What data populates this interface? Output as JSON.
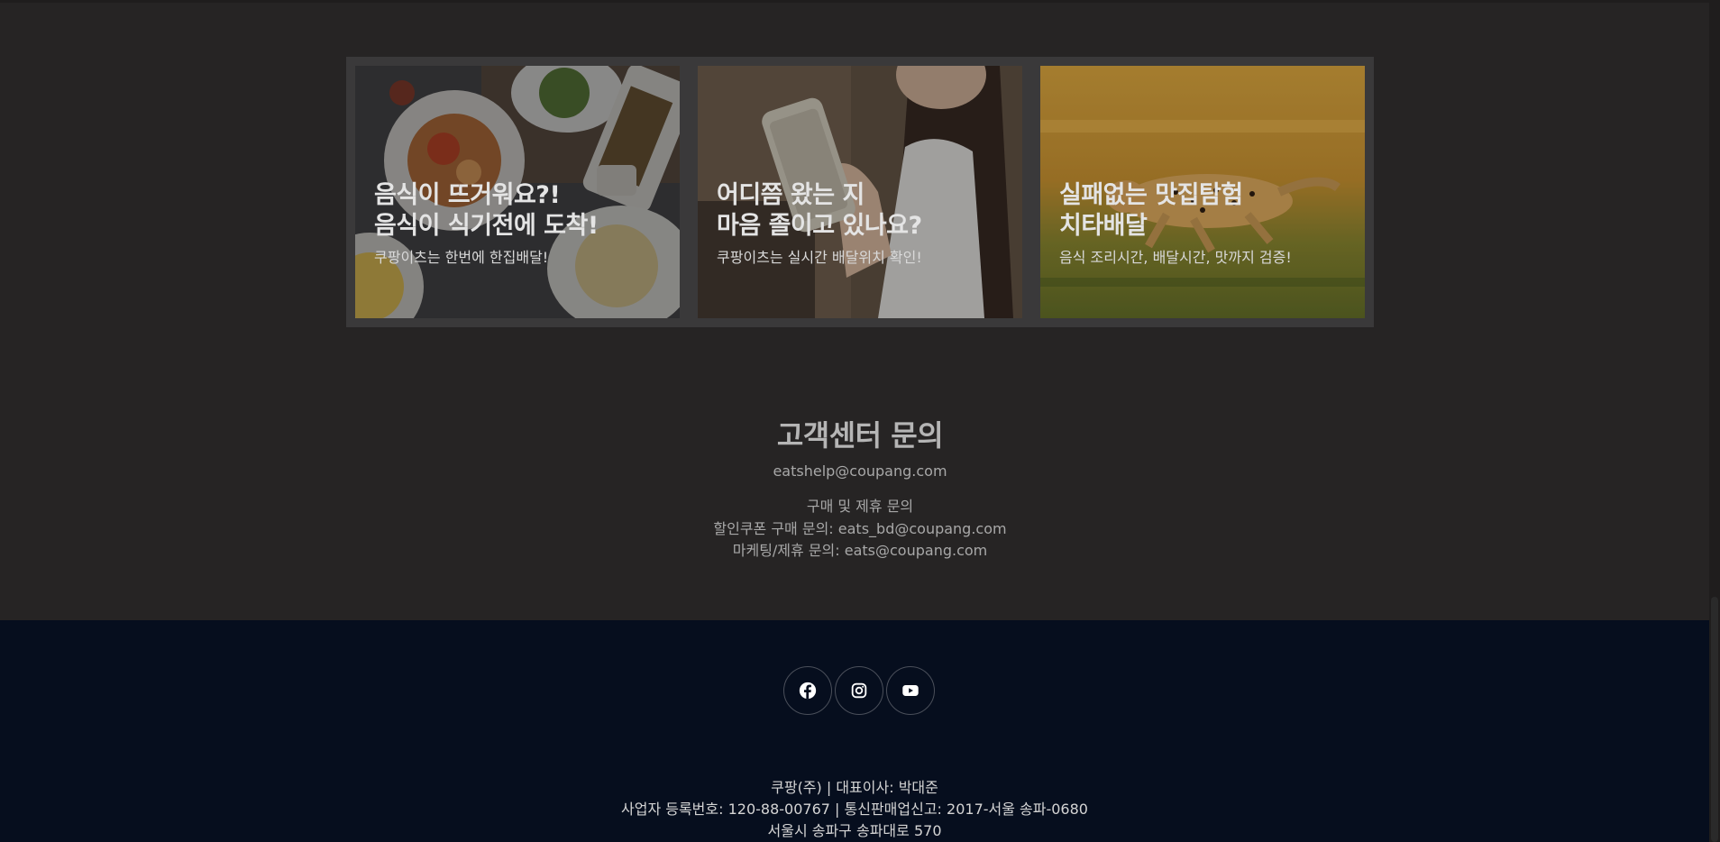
{
  "promo": {
    "cards": [
      {
        "title_line1": "음식이 뜨거워요?!",
        "title_line2": "음식이 식기전에 도착!",
        "subtitle": "쿠팡이츠는 한번에 한집배달!"
      },
      {
        "title_line1": "어디쯤 왔는 지",
        "title_line2": "마음 졸이고 있나요?",
        "subtitle": "쿠팡이츠는 실시간 배달위치 확인!"
      },
      {
        "title_line1": "실패없는 맛집탐험",
        "title_line2": "치타배달",
        "subtitle": "음식 조리시간, 배달시간, 맛까지 검증!"
      }
    ]
  },
  "customer_service": {
    "title": "고객센터 문의",
    "email": "eatshelp@coupang.com",
    "partnership_heading": "구매 및 제휴 문의",
    "coupon_inquiry": "할인쿠폰 구매 문의: eats_bd@coupang.com",
    "marketing_inquiry": "마케팅/제휴 문의: eats@coupang.com"
  },
  "footer": {
    "social": [
      "facebook-icon",
      "instagram-icon",
      "youtube-icon"
    ],
    "company_line": "쿠팡(주) | 대표이사: 박대준",
    "registration_line": "사업자 등록번호: 120-88-00767 | 통신판매업신고: 2017-서울 송파-0680",
    "address_line": "서울시 송파구 송파대로 570"
  },
  "colors": {
    "page_bg": "#262424",
    "footer_bg": "#060e1e",
    "frame_bg": "#3a393a"
  }
}
